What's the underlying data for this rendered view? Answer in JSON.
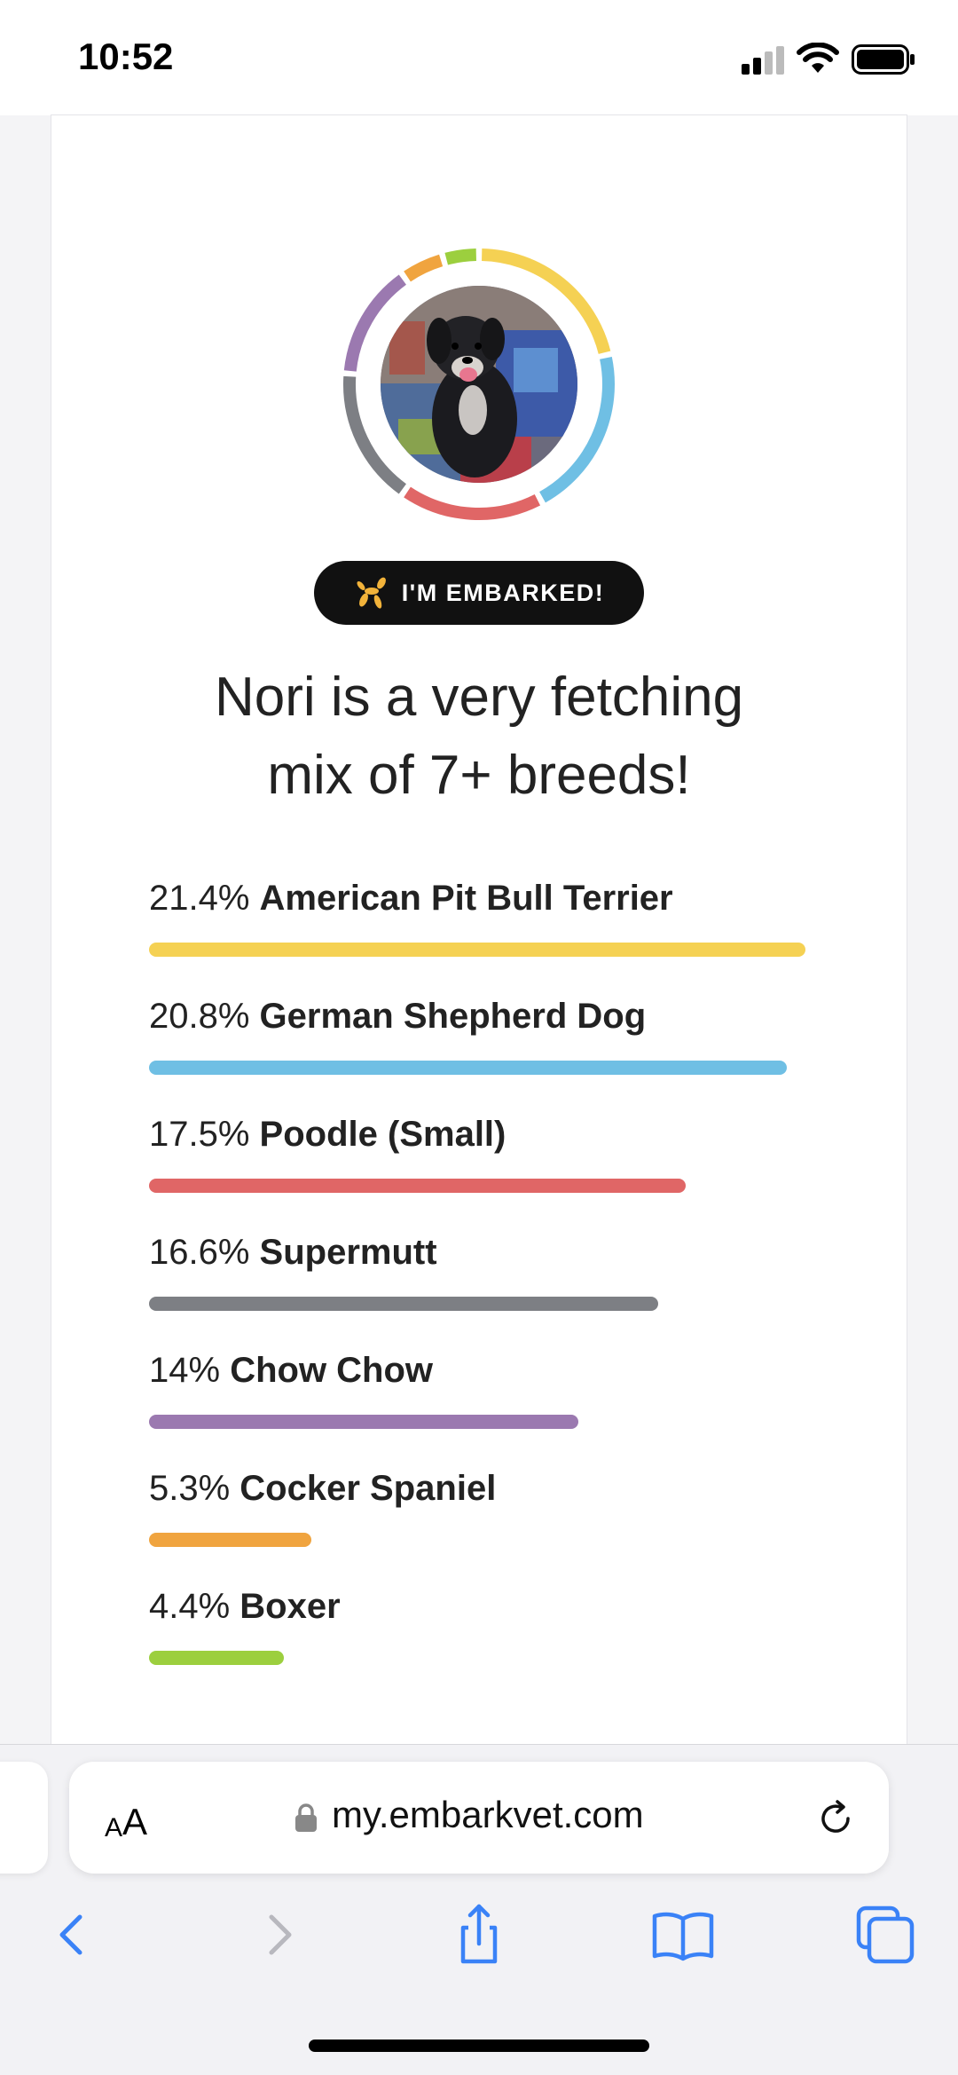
{
  "status_bar": {
    "time": "10:52"
  },
  "card": {
    "badge_label": "I'M EMBARKED!",
    "headline_line1": "Nori is a very fetching",
    "headline_line2": "mix of 7+ breeds!",
    "breeds": [
      {
        "percent_text": "21.4%",
        "name": "American Pit Bull Terrier",
        "percent": 21.4,
        "color": "#f5d153"
      },
      {
        "percent_text": "20.8%",
        "name": "German Shepherd Dog",
        "percent": 20.8,
        "color": "#6fbfe4"
      },
      {
        "percent_text": "17.5%",
        "name": "Poodle (Small)",
        "percent": 17.5,
        "color": "#e06666"
      },
      {
        "percent_text": "16.6%",
        "name": "Supermutt",
        "percent": 16.6,
        "color": "#7d7f84"
      },
      {
        "percent_text": "14%",
        "name": "Chow Chow",
        "percent": 14,
        "color": "#9b79b0"
      },
      {
        "percent_text": "5.3%",
        "name": "Cocker Spaniel",
        "percent": 5.3,
        "color": "#f0a43f"
      },
      {
        "percent_text": "4.4%",
        "name": "Boxer",
        "percent": 4.4,
        "color": "#9ccf3e"
      }
    ]
  },
  "browser": {
    "aa_small": "A",
    "aa_large": "A",
    "url": "my.embarkvet.com",
    "accent_color": "#3a82f7"
  }
}
